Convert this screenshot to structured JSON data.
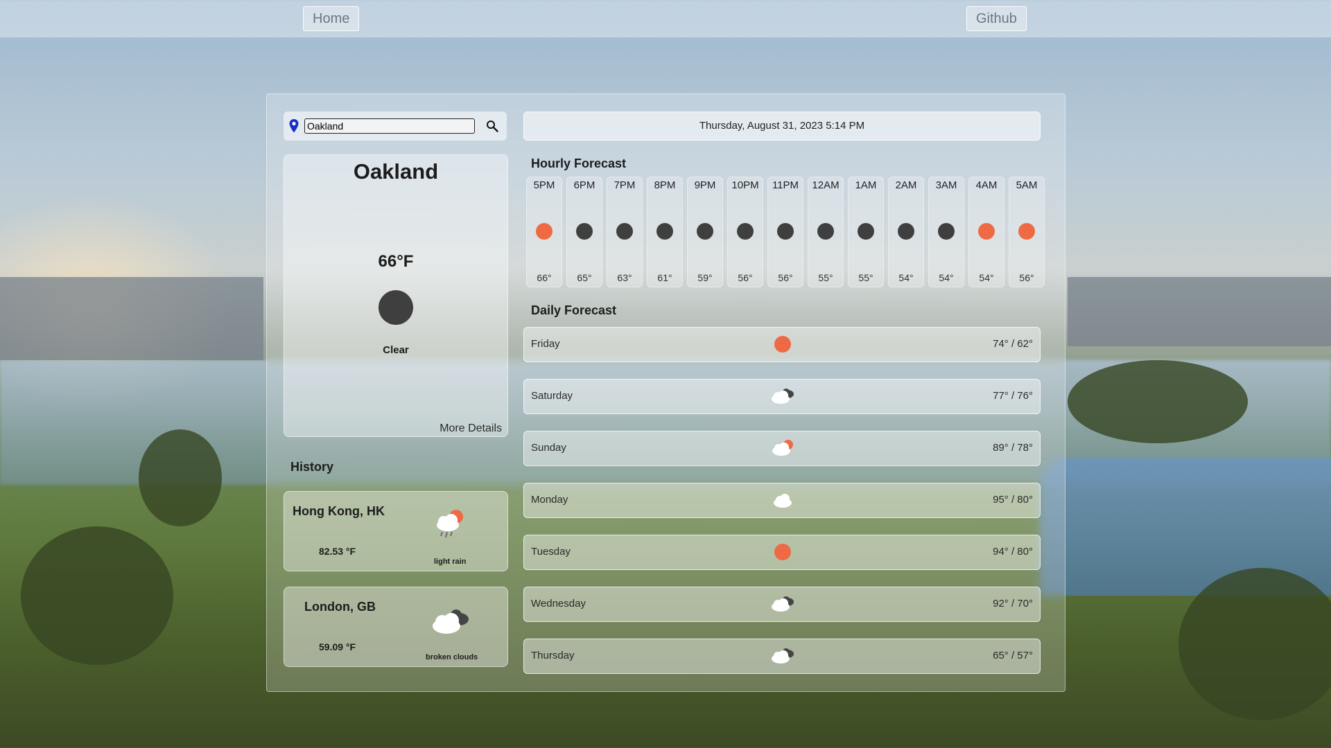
{
  "nav": {
    "home_label": "Home",
    "github_label": "Github"
  },
  "search": {
    "value": "Oakland"
  },
  "datetime": "Thursday, August 31, 2023 5:14 PM",
  "current": {
    "city": "Oakland",
    "temp": "66°F",
    "condition": "Clear",
    "more_label": "More Details"
  },
  "history": {
    "title": "History",
    "items": [
      {
        "name": "Hong Kong, HK",
        "temp": "82.53 °F",
        "desc": "light rain",
        "icon": "rain-cloud-sun-icon"
      },
      {
        "name": "London, GB",
        "temp": "59.09 °F",
        "desc": "broken clouds",
        "icon": "broken-clouds-icon"
      }
    ]
  },
  "hourly": {
    "title": "Hourly Forecast",
    "items": [
      {
        "time": "5PM",
        "temp": "66°",
        "icon": "sun-icon"
      },
      {
        "time": "6PM",
        "temp": "65°",
        "icon": "moon-icon"
      },
      {
        "time": "7PM",
        "temp": "63°",
        "icon": "moon-icon"
      },
      {
        "time": "8PM",
        "temp": "61°",
        "icon": "moon-icon"
      },
      {
        "time": "9PM",
        "temp": "59°",
        "icon": "moon-icon"
      },
      {
        "time": "10PM",
        "temp": "56°",
        "icon": "moon-icon"
      },
      {
        "time": "11PM",
        "temp": "56°",
        "icon": "moon-icon"
      },
      {
        "time": "12AM",
        "temp": "55°",
        "icon": "moon-icon"
      },
      {
        "time": "1AM",
        "temp": "55°",
        "icon": "moon-icon"
      },
      {
        "time": "2AM",
        "temp": "54°",
        "icon": "moon-icon"
      },
      {
        "time": "3AM",
        "temp": "54°",
        "icon": "moon-icon"
      },
      {
        "time": "4AM",
        "temp": "54°",
        "icon": "sun-icon"
      },
      {
        "time": "5AM",
        "temp": "56°",
        "icon": "sun-icon"
      }
    ]
  },
  "daily": {
    "title": "Daily Forecast",
    "items": [
      {
        "day": "Friday",
        "range": "74° / 62°",
        "icon": "sun-icon"
      },
      {
        "day": "Saturday",
        "range": "77° / 76°",
        "icon": "broken-clouds-icon"
      },
      {
        "day": "Sunday",
        "range": "89° / 78°",
        "icon": "cloud-sun-icon"
      },
      {
        "day": "Monday",
        "range": "95° / 80°",
        "icon": "cloud-icon"
      },
      {
        "day": "Tuesday",
        "range": "94° / 80°",
        "icon": "sun-icon"
      },
      {
        "day": "Wednesday",
        "range": "92° / 70°",
        "icon": "broken-clouds-icon"
      },
      {
        "day": "Thursday",
        "range": "65° / 57°",
        "icon": "broken-clouds-icon"
      }
    ]
  },
  "colors": {
    "sun": "#ee6a45",
    "moon": "#3f3f3f",
    "pin": "#1430c8"
  }
}
